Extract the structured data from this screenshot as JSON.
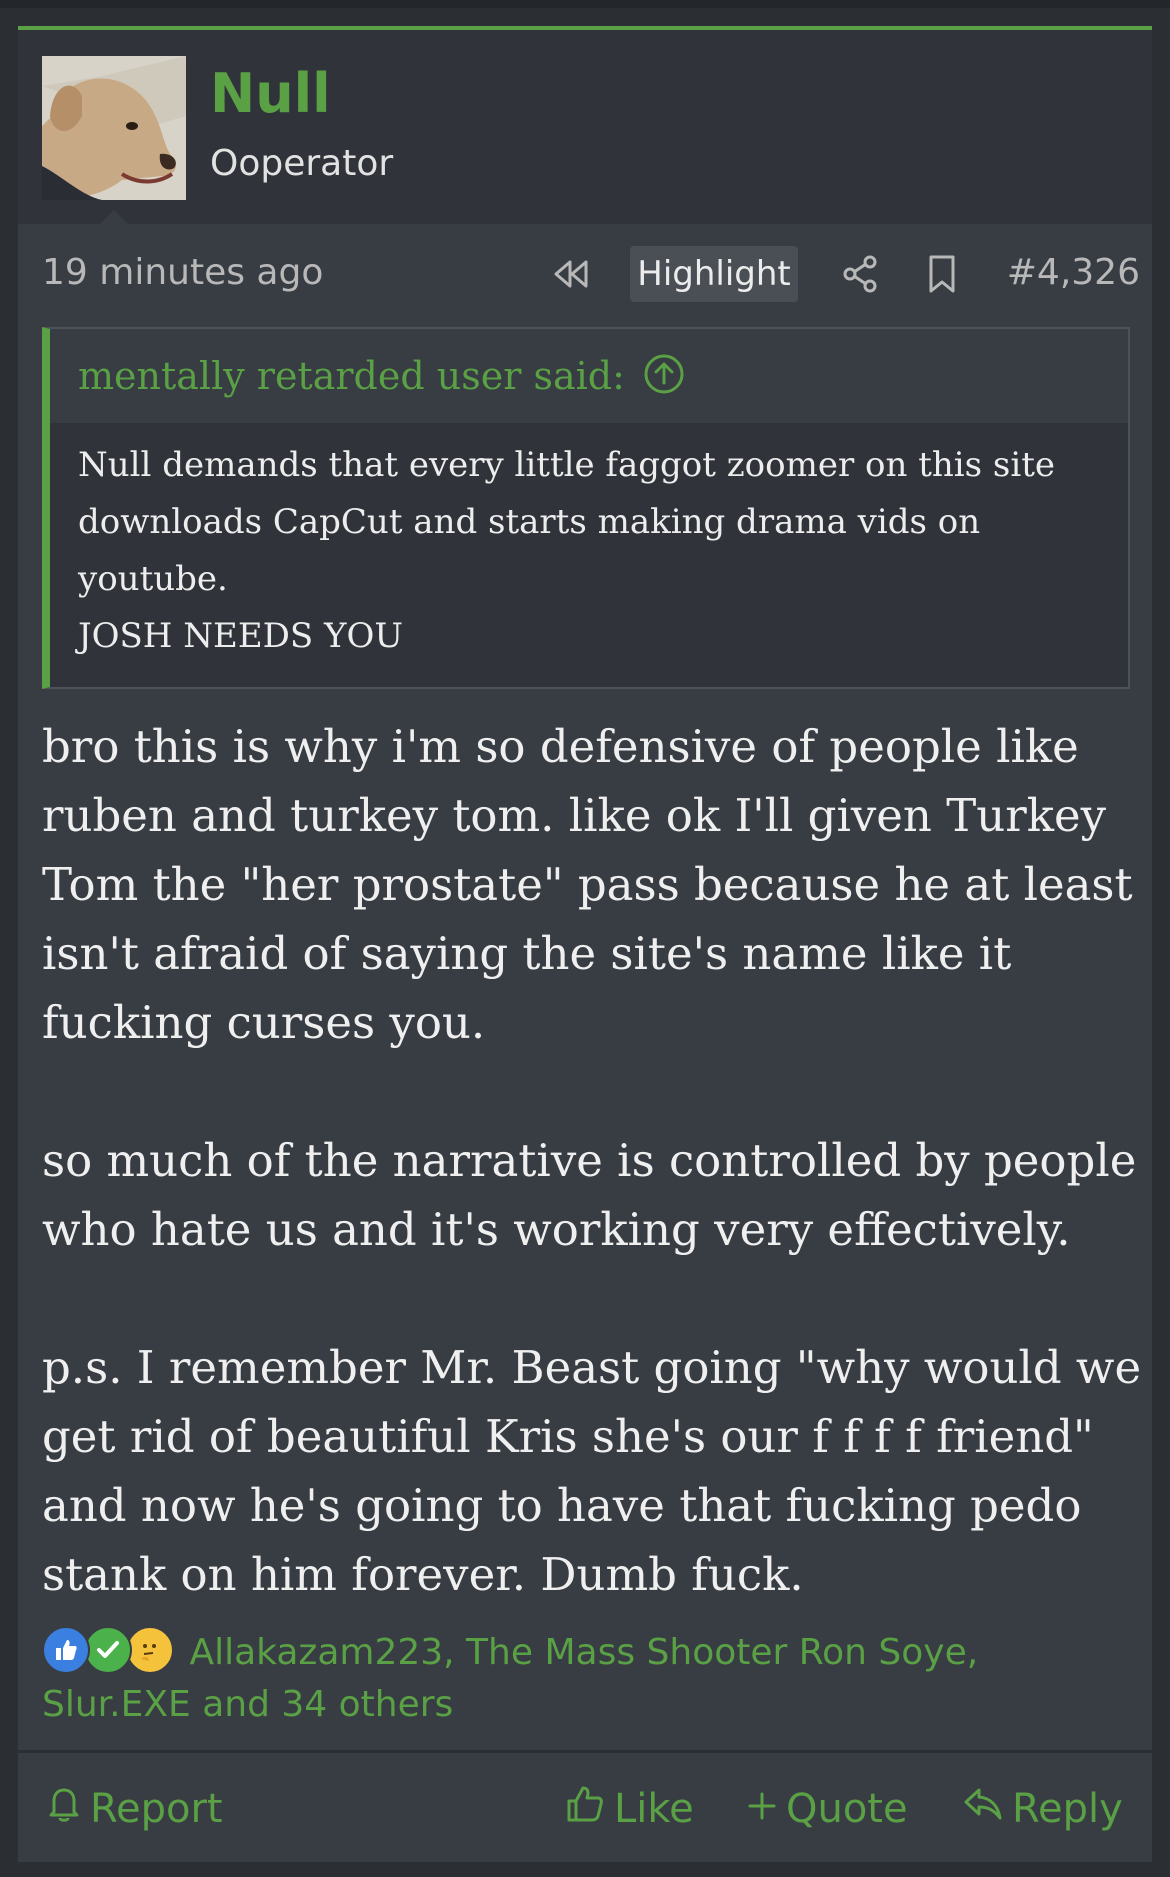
{
  "user": {
    "name": "Null",
    "title": "Ooperator"
  },
  "post": {
    "time": "19 minutes ago",
    "highlight_label": "Highlight",
    "number": "#4,326"
  },
  "quote": {
    "attribution": "mentally retarded user said:",
    "body": "Null demands that every little faggot zoomer on this site downloads CapCut and starts making drama vids on youtube.\nJOSH NEEDS YOU"
  },
  "body": {
    "p1": "bro this is why i'm so defensive of people like ruben and turkey tom. like ok I'll given Turkey Tom the \"her prostate\" pass because he at least isn't afraid of saying the site's name like it fucking curses you.",
    "p2": "so much of the narrative is controlled by people who hate us and it's working very effectively.",
    "p3": "p.s. I remember Mr. Beast going \"why would we get rid of beautiful Kris she's our f f f f friend\" and now he's going to have that fucking pedo stank on him forever. Dumb fuck."
  },
  "reactions": {
    "text": "Allakazam223, The Mass Shooter Ron Soye, Slur.EXE and 34 others",
    "icons": [
      "like-icon",
      "agree-icon",
      "thinking-icon"
    ]
  },
  "footer": {
    "report": "Report",
    "like": "Like",
    "quote": "Quote",
    "reply": "Reply"
  },
  "colors": {
    "accent": "#5aa045",
    "background": "#383c43",
    "userbar": "#30343a"
  }
}
